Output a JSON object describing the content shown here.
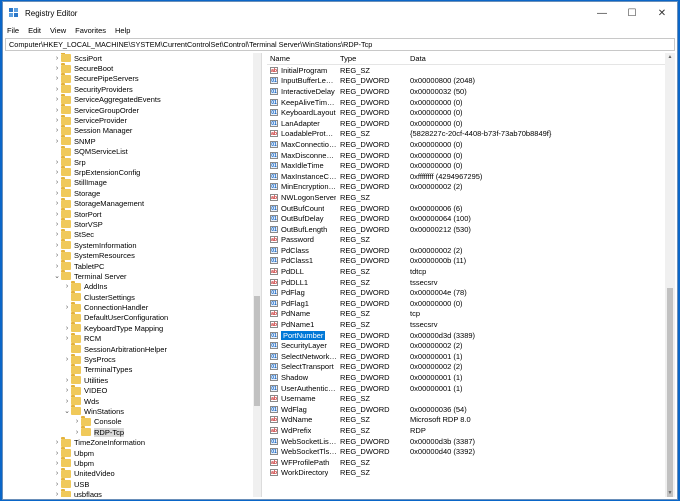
{
  "window": {
    "title": "Registry Editor",
    "controls": [
      "—",
      "☐",
      "✕"
    ]
  },
  "menu": [
    "File",
    "Edit",
    "View",
    "Favorites",
    "Help"
  ],
  "address": "Computer\\HKEY_LOCAL_MACHINE\\SYSTEM\\CurrentControlSet\\Control\\Terminal Server\\WinStations\\RDP-Tcp",
  "tree": [
    {
      "label": "ScsiPort",
      "depth": 0,
      "chev": "›"
    },
    {
      "label": "SecureBoot",
      "depth": 0,
      "chev": "›"
    },
    {
      "label": "SecurePipeServers",
      "depth": 0,
      "chev": "›"
    },
    {
      "label": "SecurityProviders",
      "depth": 0,
      "chev": "›"
    },
    {
      "label": "ServiceAggregatedEvents",
      "depth": 0,
      "chev": "›"
    },
    {
      "label": "ServiceGroupOrder",
      "depth": 0,
      "chev": "›"
    },
    {
      "label": "ServiceProvider",
      "depth": 0,
      "chev": "›"
    },
    {
      "label": "Session Manager",
      "depth": 0,
      "chev": "›"
    },
    {
      "label": "SNMP",
      "depth": 0,
      "chev": "›"
    },
    {
      "label": "SQMServiceList",
      "depth": 0,
      "chev": ""
    },
    {
      "label": "Srp",
      "depth": 0,
      "chev": "›"
    },
    {
      "label": "SrpExtensionConfig",
      "depth": 0,
      "chev": "›"
    },
    {
      "label": "StillImage",
      "depth": 0,
      "chev": "›"
    },
    {
      "label": "Storage",
      "depth": 0,
      "chev": "›"
    },
    {
      "label": "StorageManagement",
      "depth": 0,
      "chev": "›"
    },
    {
      "label": "StorPort",
      "depth": 0,
      "chev": "›"
    },
    {
      "label": "StorVSP",
      "depth": 0,
      "chev": "›"
    },
    {
      "label": "StSec",
      "depth": 0,
      "chev": "›"
    },
    {
      "label": "SystemInformation",
      "depth": 0,
      "chev": "›"
    },
    {
      "label": "SystemResources",
      "depth": 0,
      "chev": "›"
    },
    {
      "label": "TabletPC",
      "depth": 0,
      "chev": "›"
    },
    {
      "label": "Terminal Server",
      "depth": 0,
      "chev": "⌄"
    },
    {
      "label": "AddIns",
      "depth": 1,
      "chev": "›"
    },
    {
      "label": "ClusterSettings",
      "depth": 1,
      "chev": ""
    },
    {
      "label": "ConnectionHandler",
      "depth": 1,
      "chev": "›"
    },
    {
      "label": "DefaultUserConfiguration",
      "depth": 1,
      "chev": ""
    },
    {
      "label": "KeyboardType Mapping",
      "depth": 1,
      "chev": "›"
    },
    {
      "label": "RCM",
      "depth": 1,
      "chev": "›"
    },
    {
      "label": "SessionArbitrationHelper",
      "depth": 1,
      "chev": ""
    },
    {
      "label": "SysProcs",
      "depth": 1,
      "chev": "›"
    },
    {
      "label": "TerminalTypes",
      "depth": 1,
      "chev": ""
    },
    {
      "label": "Utilities",
      "depth": 1,
      "chev": "›"
    },
    {
      "label": "VIDEO",
      "depth": 1,
      "chev": "›"
    },
    {
      "label": "Wds",
      "depth": 1,
      "chev": "›"
    },
    {
      "label": "WinStations",
      "depth": 1,
      "chev": "⌄"
    },
    {
      "label": "Console",
      "depth": 2,
      "chev": "›"
    },
    {
      "label": "RDP-Tcp",
      "depth": 2,
      "chev": "›",
      "selected": true
    },
    {
      "label": "TimeZoneInformation",
      "depth": 0,
      "chev": "›"
    },
    {
      "label": "Ubpm",
      "depth": 0,
      "chev": "›"
    },
    {
      "label": "Ubpm",
      "depth": 0,
      "chev": "›"
    },
    {
      "label": "UnitedVideo",
      "depth": 0,
      "chev": "›"
    },
    {
      "label": "USB",
      "depth": 0,
      "chev": "›"
    },
    {
      "label": "usbflags",
      "depth": 0,
      "chev": "›"
    }
  ],
  "list": {
    "headers": {
      "name": "Name",
      "type": "Type",
      "data": "Data"
    },
    "rows": [
      {
        "name": "InitialProgram",
        "type": "REG_SZ",
        "data": "",
        "icon": "sz"
      },
      {
        "name": "InputBufferLeng...",
        "type": "REG_DWORD",
        "data": "0x00000800 (2048)",
        "icon": "dw"
      },
      {
        "name": "InteractiveDelay",
        "type": "REG_DWORD",
        "data": "0x00000032 (50)",
        "icon": "dw"
      },
      {
        "name": "KeepAliveTimeout",
        "type": "REG_DWORD",
        "data": "0x00000000 (0)",
        "icon": "dw"
      },
      {
        "name": "KeyboardLayout",
        "type": "REG_DWORD",
        "data": "0x00000000 (0)",
        "icon": "dw"
      },
      {
        "name": "LanAdapter",
        "type": "REG_DWORD",
        "data": "0x00000000 (0)",
        "icon": "dw"
      },
      {
        "name": "LoadableProtoc...",
        "type": "REG_SZ",
        "data": "{5828227c-20cf-4408-b73f-73ab70b8849f}",
        "icon": "sz"
      },
      {
        "name": "MaxConnection...",
        "type": "REG_DWORD",
        "data": "0x00000000 (0)",
        "icon": "dw"
      },
      {
        "name": "MaxDisconnecti...",
        "type": "REG_DWORD",
        "data": "0x00000000 (0)",
        "icon": "dw"
      },
      {
        "name": "MaxIdleTime",
        "type": "REG_DWORD",
        "data": "0x00000000 (0)",
        "icon": "dw"
      },
      {
        "name": "MaxInstanceCo...",
        "type": "REG_DWORD",
        "data": "0xffffffff (4294967295)",
        "icon": "dw"
      },
      {
        "name": "MinEncryptionL...",
        "type": "REG_DWORD",
        "data": "0x00000002 (2)",
        "icon": "dw"
      },
      {
        "name": "NWLogonServer",
        "type": "REG_SZ",
        "data": "",
        "icon": "sz"
      },
      {
        "name": "OutBufCount",
        "type": "REG_DWORD",
        "data": "0x00000006 (6)",
        "icon": "dw"
      },
      {
        "name": "OutBufDelay",
        "type": "REG_DWORD",
        "data": "0x00000064 (100)",
        "icon": "dw"
      },
      {
        "name": "OutBufLength",
        "type": "REG_DWORD",
        "data": "0x00000212 (530)",
        "icon": "dw"
      },
      {
        "name": "Password",
        "type": "REG_SZ",
        "data": "",
        "icon": "sz"
      },
      {
        "name": "PdClass",
        "type": "REG_DWORD",
        "data": "0x00000002 (2)",
        "icon": "dw"
      },
      {
        "name": "PdClass1",
        "type": "REG_DWORD",
        "data": "0x0000000b (11)",
        "icon": "dw"
      },
      {
        "name": "PdDLL",
        "type": "REG_SZ",
        "data": "tdtcp",
        "icon": "sz"
      },
      {
        "name": "PdDLL1",
        "type": "REG_SZ",
        "data": "tssecsrv",
        "icon": "sz"
      },
      {
        "name": "PdFlag",
        "type": "REG_DWORD",
        "data": "0x0000004e (78)",
        "icon": "dw"
      },
      {
        "name": "PdFlag1",
        "type": "REG_DWORD",
        "data": "0x00000000 (0)",
        "icon": "dw"
      },
      {
        "name": "PdName",
        "type": "REG_SZ",
        "data": "tcp",
        "icon": "sz"
      },
      {
        "name": "PdName1",
        "type": "REG_SZ",
        "data": "tssecsrv",
        "icon": "sz"
      },
      {
        "name": "PortNumber",
        "type": "REG_DWORD",
        "data": "0x00000d3d (3389)",
        "icon": "dw",
        "selected": true
      },
      {
        "name": "SecurityLayer",
        "type": "REG_DWORD",
        "data": "0x00000002 (2)",
        "icon": "dw"
      },
      {
        "name": "SelectNetworkD...",
        "type": "REG_DWORD",
        "data": "0x00000001 (1)",
        "icon": "dw"
      },
      {
        "name": "SelectTransport",
        "type": "REG_DWORD",
        "data": "0x00000002 (2)",
        "icon": "dw"
      },
      {
        "name": "Shadow",
        "type": "REG_DWORD",
        "data": "0x00000001 (1)",
        "icon": "dw"
      },
      {
        "name": "UserAuthenticat...",
        "type": "REG_DWORD",
        "data": "0x00000001 (1)",
        "icon": "dw"
      },
      {
        "name": "Username",
        "type": "REG_SZ",
        "data": "",
        "icon": "sz"
      },
      {
        "name": "WdFlag",
        "type": "REG_DWORD",
        "data": "0x00000036 (54)",
        "icon": "dw"
      },
      {
        "name": "WdName",
        "type": "REG_SZ",
        "data": "Microsoft RDP 8.0",
        "icon": "sz"
      },
      {
        "name": "WdPrefix",
        "type": "REG_SZ",
        "data": "RDP",
        "icon": "sz"
      },
      {
        "name": "WebSocketListe...",
        "type": "REG_DWORD",
        "data": "0x00000d3b (3387)",
        "icon": "dw"
      },
      {
        "name": "WebSocketTlsLis...",
        "type": "REG_DWORD",
        "data": "0x00000d40 (3392)",
        "icon": "dw"
      },
      {
        "name": "WFProfilePath",
        "type": "REG_SZ",
        "data": "",
        "icon": "sz"
      },
      {
        "name": "WorkDirectory",
        "type": "REG_SZ",
        "data": "",
        "icon": "sz"
      }
    ]
  }
}
